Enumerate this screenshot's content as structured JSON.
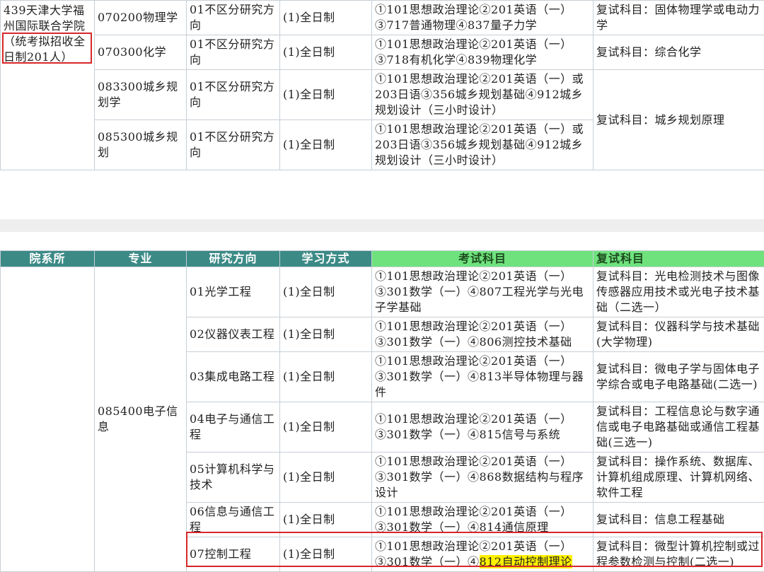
{
  "table_top": {
    "institute": "439天津大学福州国际联合学院",
    "institute_note": "（统考拟招收全日制201人）",
    "rows": [
      {
        "major": "070200物理学",
        "direction": "01不区分研究方向",
        "mode": "(1)全日制",
        "exam": "①101思想政治理论②201英语（一）③717普通物理④837量子力学",
        "retest": "复试科目：固体物理学或电动力学"
      },
      {
        "major": "070300化学",
        "direction": "01不区分研究方向",
        "mode": "(1)全日制",
        "exam": "①101思想政治理论②201英语（一）③718有机化学④839物理化学",
        "retest": "复试科目：综合化学"
      },
      {
        "major": "083300城乡规划学",
        "direction": "01不区分研究方向",
        "mode": "(1)全日制",
        "exam": "①101思想政治理论②201英语（一）或203日语③356城乡规划基础④912城乡规划设计（三小时设计）",
        "retest": "复试科目：城乡规划原理"
      },
      {
        "major": "085300城乡规划",
        "direction": "01不区分研究方向",
        "mode": "(1)全日制",
        "exam": "①101思想政治理论②201英语（一）或203日语③356城乡规划基础④912城乡规划设计（三小时设计）"
      }
    ]
  },
  "table_bottom": {
    "headers": [
      "院系所",
      "专业",
      "研究方向",
      "学习方式",
      "考试科目",
      "复试科目"
    ],
    "major": "085400电子信息",
    "rows": [
      {
        "direction": "01光学工程",
        "mode": "(1)全日制",
        "exam": "①101思想政治理论②201英语（一）③301数学（一）④807工程光学与光电子学基础",
        "retest": "复试科目：光电检测技术与图像传感器应用技术或光电子技术基础（二选一）"
      },
      {
        "direction": "02仪器仪表工程",
        "mode": "(1)全日制",
        "exam": "①101思想政治理论②201英语（一）③301数学（一）④806测控技术基础",
        "retest": "复试科目：仪器科学与技术基础(大学物理)"
      },
      {
        "direction": "03集成电路工程",
        "mode": "(1)全日制",
        "exam": "①101思想政治理论②201英语（一）③301数学（一）④813半导体物理与器件",
        "retest": "复试科目：微电子学与固体电子学综合或电子电路基础(二选一)"
      },
      {
        "direction": "04电子与通信工程",
        "mode": "(1)全日制",
        "exam": "①101思想政治理论②201英语（一）③301数学（一）④815信号与系统",
        "retest": "复试科目：工程信息论与数字通信或电子电路基础或通信工程基础(三选一)"
      },
      {
        "direction": "05计算机科学与技术",
        "mode": "(1)全日制",
        "exam": "①101思想政治理论②201英语（一）③301数学（一）④868数据结构与程序设计",
        "retest": "复试科目：操作系统、数据库、计算机组成原理、计算机网络、软件工程"
      },
      {
        "direction": "06信息与通信工程",
        "mode": "(1)全日制",
        "exam": "①101思想政治理论②201英语（一）③301数学（一）④814通信原理",
        "retest": "复试科目：信息工程基础"
      },
      {
        "direction": "07控制工程",
        "mode": "(1)全日制",
        "exam_prefix": "①101思想政治理论②201英语（一）③301数学（一）④",
        "exam_highlight": "812自动控制理论",
        "retest": "复试科目：微型计算机控制或过程参数检测与控制(二选一)"
      }
    ]
  },
  "colors": {
    "header_bg": "#3b8a86",
    "header_highlight": "#6fe27e",
    "annotation_red": "#d7272a",
    "text_highlight": "#fff100"
  }
}
